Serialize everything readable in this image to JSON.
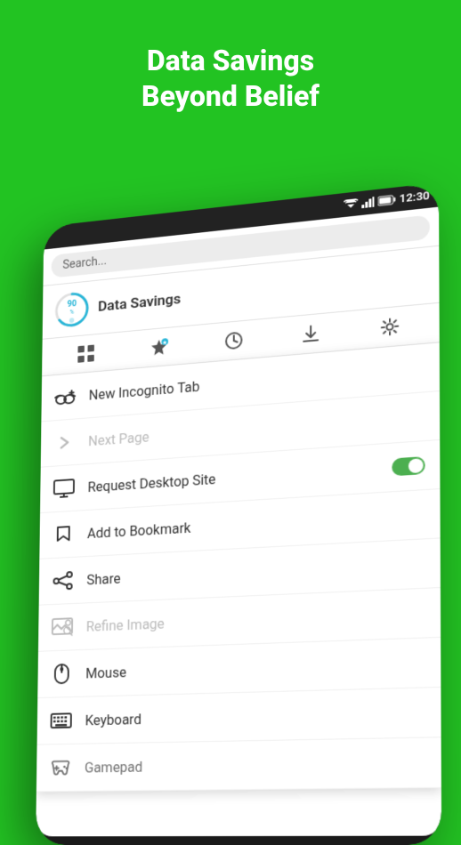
{
  "hero": {
    "title_line1": "Data Savings",
    "title_line2": "Beyond Belief"
  },
  "status_bar": {
    "time": "12:30"
  },
  "address_bar": {
    "placeholder": "Search..."
  },
  "data_savings": {
    "label": "Data Savings",
    "percent": "90",
    "percent_suffix": "%"
  },
  "toolbar": {
    "icons": [
      "grid-icon",
      "star-icon",
      "clock-icon",
      "download-icon",
      "settings-icon"
    ]
  },
  "menu_items": [
    {
      "id": "new-incognito-tab",
      "label": "New Incognito Tab",
      "disabled": false,
      "has_toggle": false
    },
    {
      "id": "next-page",
      "label": "Next Page",
      "disabled": true,
      "has_toggle": false
    },
    {
      "id": "request-desktop-site",
      "label": "Request Desktop Site",
      "disabled": false,
      "has_toggle": true
    },
    {
      "id": "add-to-bookmark",
      "label": "Add to Bookmark",
      "disabled": false,
      "has_toggle": false
    },
    {
      "id": "share",
      "label": "Share",
      "disabled": false,
      "has_toggle": false
    },
    {
      "id": "refine-image",
      "label": "Refine Image",
      "disabled": true,
      "has_toggle": false
    },
    {
      "id": "mouse",
      "label": "Mouse",
      "disabled": false,
      "has_toggle": false
    },
    {
      "id": "keyboard",
      "label": "Keyboard",
      "disabled": false,
      "has_toggle": false
    },
    {
      "id": "gamepad",
      "label": "Gamepad",
      "disabled": false,
      "has_toggle": false
    }
  ],
  "colors": {
    "bg_green": "#22c322",
    "accent_blue": "#29b6d8",
    "toggle_green": "#4CAF50"
  }
}
